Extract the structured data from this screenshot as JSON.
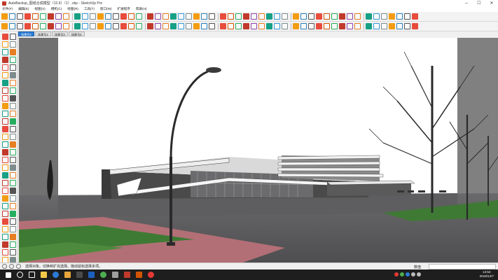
{
  "window": {
    "title": "AutoBackup_图纸合成模型（12.6）（1）.skp - SketchUp Pro",
    "minimize_glyph": "─",
    "maximize_glyph": "☐",
    "close_glyph": "✕"
  },
  "menu": {
    "items": [
      "文件(F)",
      "编辑(E)",
      "视图(V)",
      "相机(C)",
      "绘图(R)",
      "工具(T)",
      "窗口(W)",
      "扩展程序",
      "帮助(H)"
    ]
  },
  "scene_tabs": [
    "场景号1",
    "场景号2",
    "场景号3",
    "场景号4"
  ],
  "statusbar": {
    "hint": "选择对象。切换到扩充选择。拖动鼠标选择多项。",
    "measurement_label": "数值",
    "measurement_value": ""
  },
  "taskbar": {
    "time": "14:52",
    "date": "2018/12/7"
  },
  "colors": {
    "accent": "#2b7bd6",
    "sky": "#ffffff",
    "road": "#58585a",
    "grass": "#3f7a35",
    "brick": "#b06f74"
  }
}
